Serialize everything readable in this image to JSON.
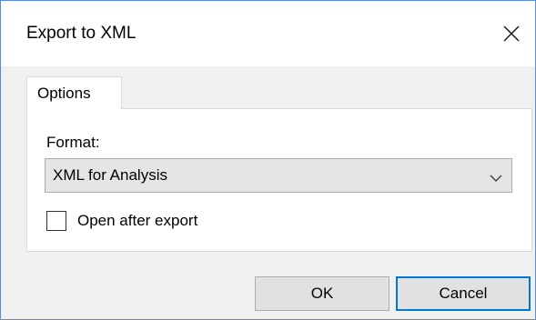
{
  "window": {
    "title": "Export to XML",
    "close_icon": "close-icon"
  },
  "tabs": [
    {
      "label": "Options",
      "active": true
    }
  ],
  "options": {
    "format_label": "Format:",
    "format_selected": "XML for Analysis",
    "dropdown_icon": "chevron-down-icon",
    "open_after_export_label": "Open after export",
    "open_after_export_checked": false
  },
  "buttons": {
    "ok_label": "OK",
    "cancel_label": "Cancel"
  },
  "colors": {
    "window_border": "#5a8fd6",
    "focus_border": "#0078d7",
    "dialog_bg": "#f0f0f0"
  }
}
